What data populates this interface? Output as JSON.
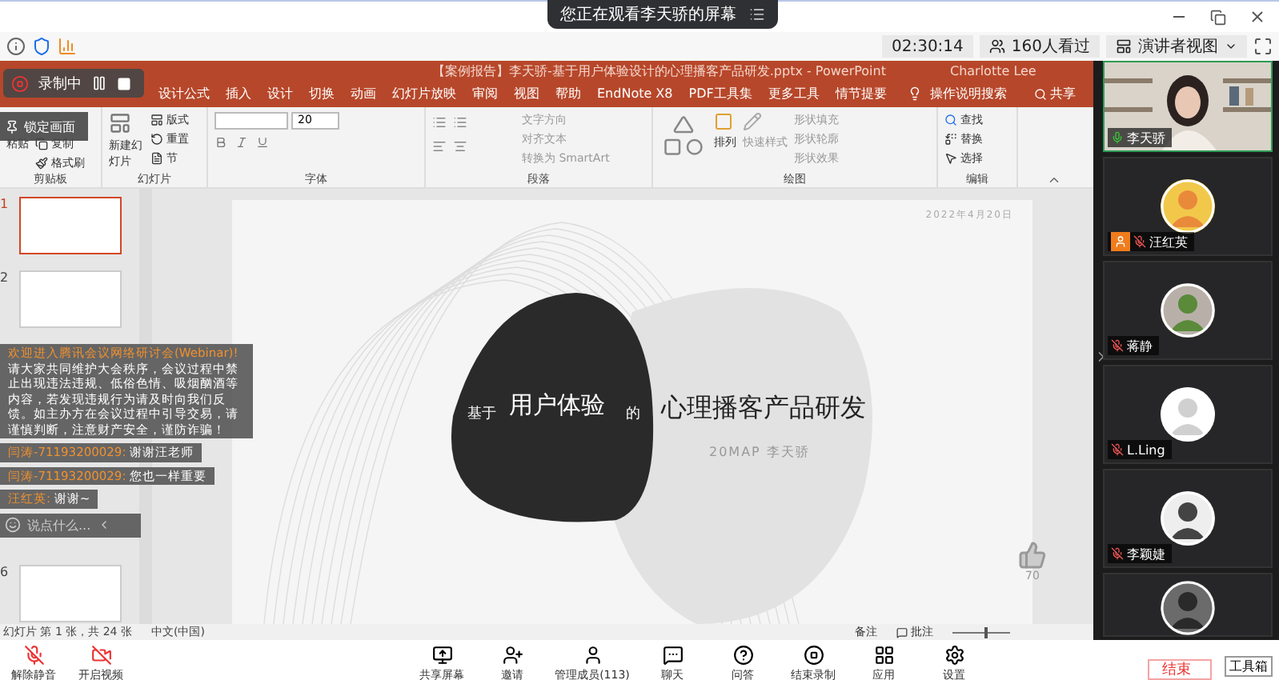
{
  "viewing_banner": {
    "text": "您正在观看李天骄的屏幕"
  },
  "meeting_bar": {
    "timer": "02:30:14",
    "viewers": "160人看过",
    "view_mode": "演讲者视图"
  },
  "recording": {
    "label": "录制中",
    "lock_label": "锁定画面"
  },
  "powerpoint": {
    "title": "【案例报告】李天骄-基于用户体验设计的心理播客产品研发.pptx  -  PowerPoint",
    "user": "Charlotte Lee",
    "ribbon_tabs": [
      "设计公式",
      "插入",
      "设计",
      "切换",
      "动画",
      "幻灯片放映",
      "审阅",
      "视图",
      "帮助",
      "EndNote X8",
      "PDF工具集",
      "更多工具",
      "情节提要"
    ],
    "search": "操作说明搜索",
    "share": "共享",
    "ribbon": {
      "clipboard": {
        "label": "剪贴板",
        "paste": "粘贴",
        "copy": "复制",
        "format_painter": "格式刷"
      },
      "slides": {
        "label": "幻灯片",
        "new_slide": "新建幻灯片",
        "layout": "版式",
        "reset": "重置",
        "section": "节"
      },
      "font": {
        "label": "字体",
        "size": "20"
      },
      "paragraph": {
        "label": "段落",
        "items": [
          "文字方向",
          "对齐文本",
          "转换为 SmartArt"
        ]
      },
      "drawing": {
        "label": "绘图",
        "arrange": "排列",
        "quick_styles": "快速样式",
        "items": [
          "形状填充",
          "形状轮廓",
          "形状效果"
        ]
      },
      "editing": {
        "label": "编辑",
        "items": [
          "查找",
          "替换",
          "选择"
        ]
      }
    },
    "thumbnails": [
      {
        "number": "1",
        "selected": true
      },
      {
        "number": "2",
        "selected": false
      },
      {
        "number": "6",
        "selected": false
      }
    ],
    "slide": {
      "date": "2022年4月20日",
      "prefix": "基于",
      "highlight": "用户体验",
      "joiner": "的",
      "rest": "心理播客产品研发",
      "author": "20MAP 李天骄"
    },
    "status_bar": {
      "slide_info": "幻灯片 第 1 张，共 24 张",
      "language": "中文(中国)",
      "notes": "备注",
      "comments": "批注",
      "zoom": {
        "level": 0.55
      }
    }
  },
  "chat": {
    "notice_title": "欢迎进入腾讯会议网络研讨会(Webinar)!",
    "notice_body": "请大家共同维护大会秩序，会议过程中禁止出现违法违规、低俗色情、吸烟酗酒等内容，若发现违规行为请及时向我们反馈。如主办方在会议过程中引导交易，请谨慎判断，注意财产安全，谨防诈骗！",
    "messages": [
      {
        "sender": "闫涛-71193200029:",
        "text": "谢谢汪老师"
      },
      {
        "sender": "闫涛-71193200029:",
        "text": "您也一样重要"
      },
      {
        "sender": "汪红英:",
        "text": "谢谢~"
      }
    ],
    "placeholder": "说点什么..."
  },
  "likes": "70",
  "participants": [
    {
      "name": "李天骄",
      "kind": "video",
      "muted": false,
      "host": false
    },
    {
      "name": "汪红英",
      "kind": "avatar",
      "muted": true,
      "host": true
    },
    {
      "name": "蒋静",
      "kind": "avatar",
      "muted": true,
      "host": false
    },
    {
      "name": "L.Ling",
      "kind": "avatar",
      "muted": true,
      "host": false
    },
    {
      "name": "李颖婕",
      "kind": "avatar",
      "muted": true,
      "host": false
    },
    {
      "kind": "avatar"
    }
  ],
  "toolbar": {
    "left": [
      {
        "label": "解除静音",
        "kind": "mic"
      },
      {
        "label": "开启视频",
        "kind": "camera"
      }
    ],
    "center": [
      {
        "label": "共享屏幕",
        "kind": "share"
      },
      {
        "label": "邀请",
        "kind": "invite"
      },
      {
        "label": "管理成员(113)",
        "kind": "members"
      },
      {
        "label": "聊天",
        "kind": "chat"
      },
      {
        "label": "问答",
        "kind": "qa"
      },
      {
        "label": "结束录制",
        "kind": "record"
      },
      {
        "label": "应用",
        "kind": "apps"
      },
      {
        "label": "设置",
        "kind": "settings"
      }
    ],
    "end_button": "结束",
    "tooltip": "工具箱"
  }
}
